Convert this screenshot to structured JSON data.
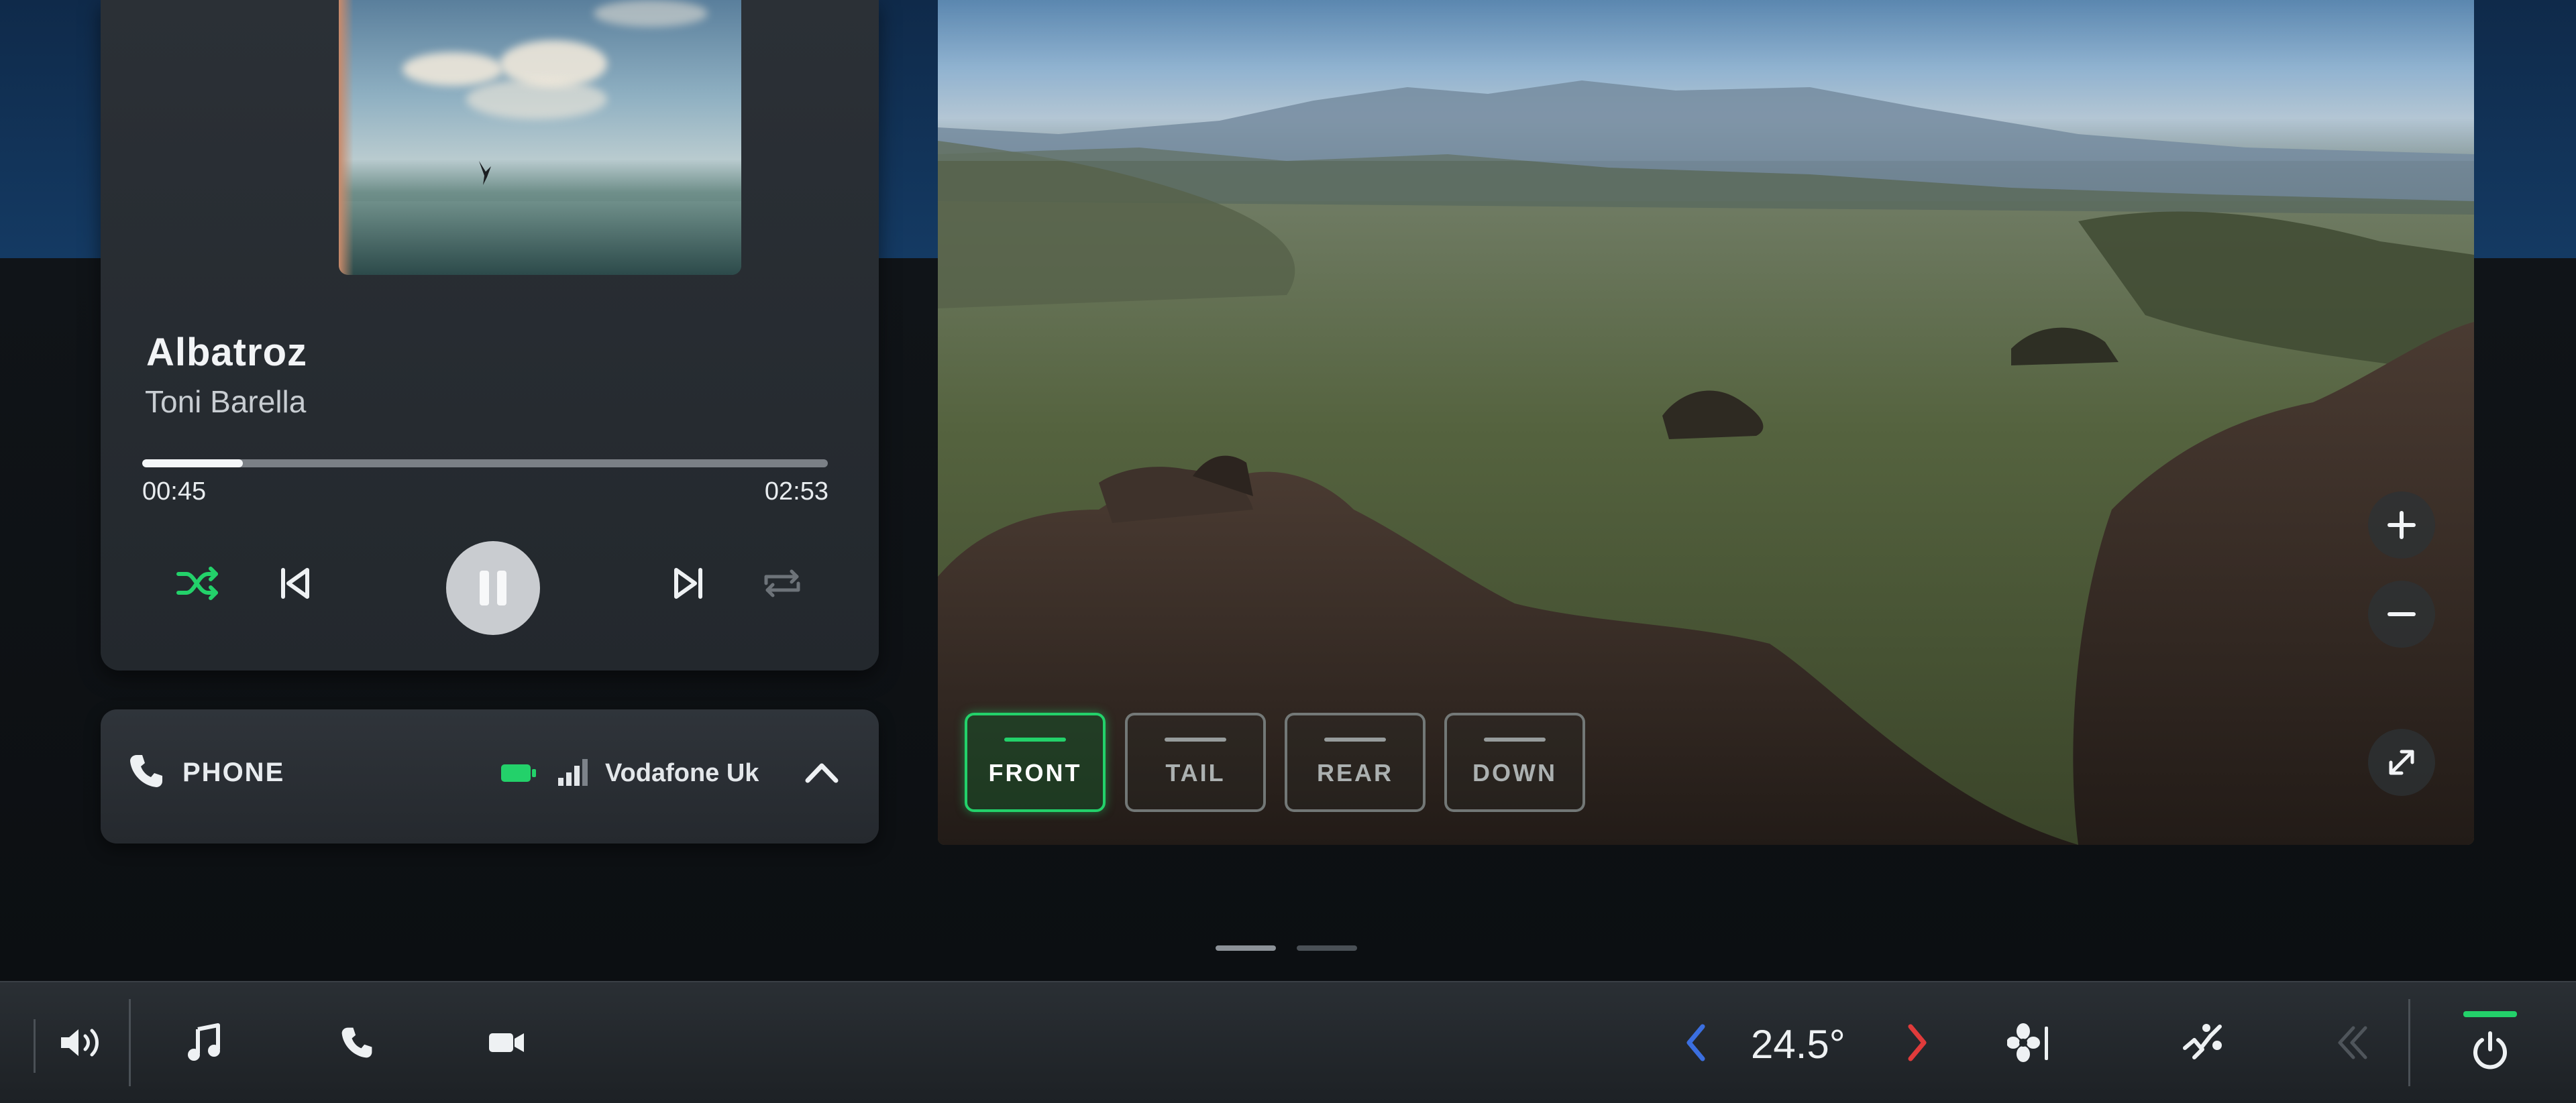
{
  "media": {
    "song_title": "Albatroz",
    "artist": "Toni Barella",
    "elapsed": "00:45",
    "duration": "02:53",
    "progress_fraction": 0.147,
    "shuffle_active": true,
    "icons": [
      "shuffle-icon",
      "previous-track-icon",
      "pause-icon",
      "next-track-icon",
      "repeat-icon"
    ]
  },
  "phone": {
    "label": "PHONE",
    "carrier": "Vodafone Uk",
    "icons": [
      "phone-icon",
      "battery-icon",
      "signal-icon",
      "chevron-up-icon"
    ]
  },
  "camera": {
    "views": [
      {
        "label": "FRONT",
        "active": true
      },
      {
        "label": "TAIL",
        "active": false
      },
      {
        "label": "REAR",
        "active": false
      },
      {
        "label": "DOWN",
        "active": false
      }
    ],
    "controls": [
      "zoom-in-icon",
      "zoom-out-icon",
      "expand-icon"
    ]
  },
  "pager": {
    "pages": 2,
    "active": 0
  },
  "bottom_bar": {
    "temperature": "24.5°",
    "icons": [
      "volume-icon",
      "music-icon",
      "phone-icon",
      "camera-icon",
      "temp-decrease-icon",
      "temp-increase-icon",
      "fan-icon",
      "seat-heat-icon",
      "back-icon",
      "power-icon"
    ]
  },
  "colors": {
    "accent_green": "#23d16a",
    "temp_decrease": "#3b6fe0",
    "temp_increase": "#e03b3b",
    "panel": "#2b3036",
    "background": "#0c0f12"
  }
}
